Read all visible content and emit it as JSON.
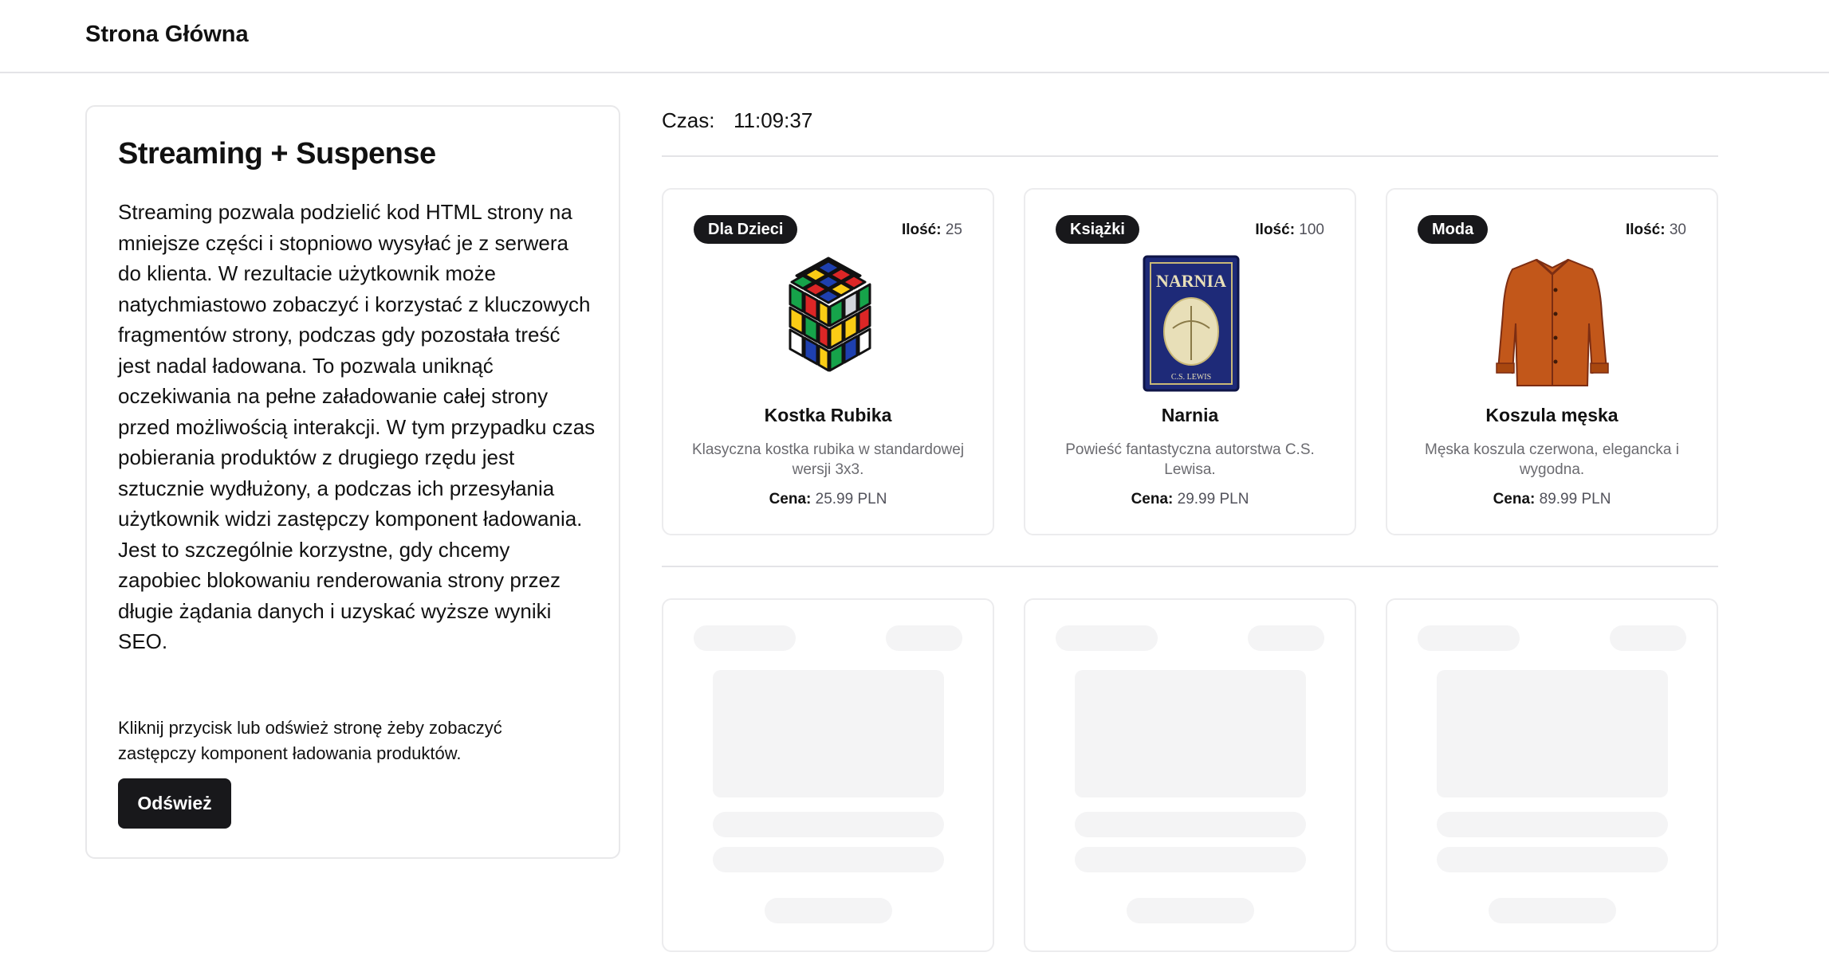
{
  "header": {
    "title": "Strona Główna"
  },
  "intro": {
    "title": "Streaming + Suspense",
    "text": "Streaming pozwala podzielić kod HTML strony na mniejsze części i stopniowo wysyłać je z serwera do klienta. W rezultacie użytkownik może natychmiastowo zobaczyć i korzystać z kluczowych fragmentów strony, podczas gdy pozostała treść jest nadal ładowana. To pozwala uniknąć oczekiwania na pełne załadowanie całej strony przed możliwością interakcji. W tym przypadku czas pobierania produktów z drugiego rzędu jest sztucznie wydłużony, a podczas ich przesyłania użytkownik widzi zastępczy komponent ładowania. Jest to szczególnie korzystne, gdy chcemy zapobiec blokowaniu renderowania strony przez długie żądania danych i uzyskać wyższe wyniki SEO.",
    "hint": "Kliknij przycisk lub odśwież stronę żeby zobaczyć zastępczy komponent ładowania produktów.",
    "button_label": "Odśwież"
  },
  "time": {
    "label": "Czas:",
    "value": "11:09:37"
  },
  "product_labels": {
    "quantity": "Ilość:",
    "price": "Cena:"
  },
  "products": [
    {
      "category": "Dla Dzieci",
      "quantity": "25",
      "name": "Kostka Rubika",
      "description": "Klasyczna kostka rubika w standardowej wersji 3x3.",
      "price": "25.99 PLN",
      "image": "rubiks-cube"
    },
    {
      "category": "Książki",
      "quantity": "100",
      "name": "Narnia",
      "description": "Powieść fantastyczna autorstwa C.S. Lewisa.",
      "price": "29.99 PLN",
      "image": "narnia-book",
      "image_text": "NARNIA",
      "image_author": "C.S. LEWIS"
    },
    {
      "category": "Moda",
      "quantity": "30",
      "name": "Koszula męska",
      "description": "Męska koszula czerwona, elegancka i wygodna.",
      "price": "89.99 PLN",
      "image": "orange-shirt"
    }
  ],
  "colors": {
    "primary": "#18181b",
    "border": "#e4e4e7",
    "skeleton": "#f4f4f5",
    "muted": "#6b6b70"
  }
}
